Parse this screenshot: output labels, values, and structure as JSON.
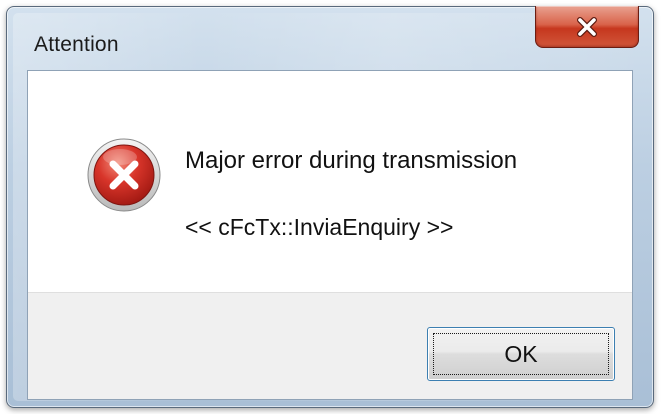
{
  "window": {
    "title": "Attention",
    "close_icon": "close-x-icon"
  },
  "message": {
    "icon": "error-icon",
    "main_text": "Major error during transmission",
    "detail_text": "<< cFcTx::InviaEnquiry >>"
  },
  "buttons": {
    "ok_label": "OK"
  },
  "colors": {
    "close_button": "#c6371e",
    "error_icon": "#c4281c",
    "focus_border": "#3c7fb1"
  }
}
